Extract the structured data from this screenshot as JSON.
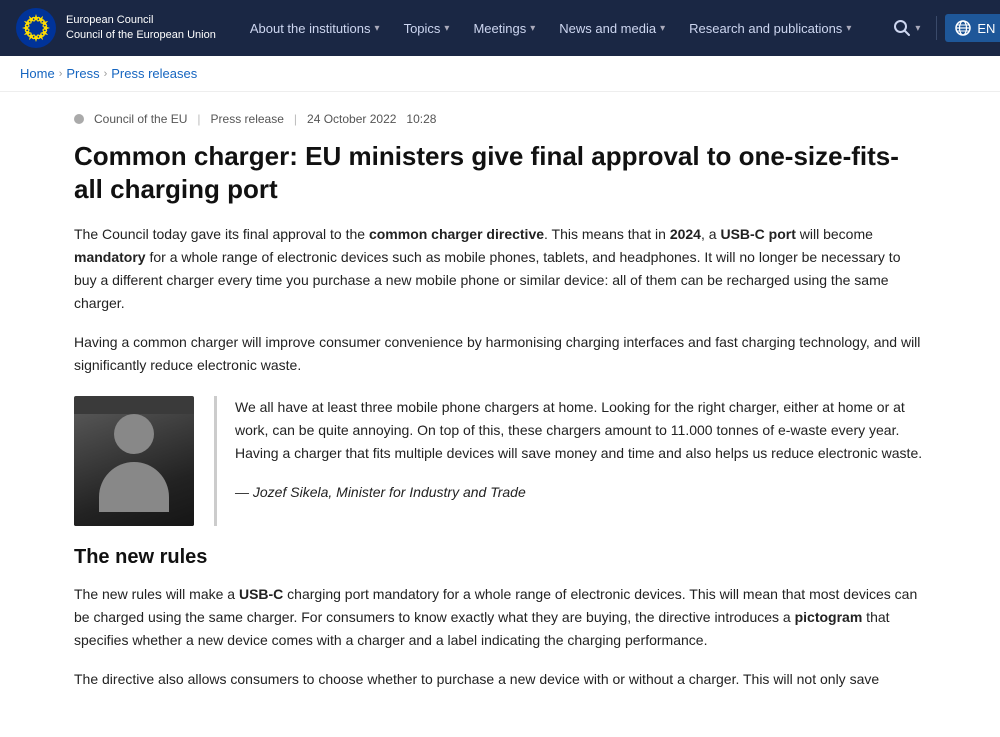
{
  "header": {
    "org_line1": "European Council",
    "org_line2": "Council of the European Union",
    "nav": [
      {
        "label": "About the institutions",
        "has_chevron": true
      },
      {
        "label": "Topics",
        "has_chevron": true
      },
      {
        "label": "Meetings",
        "has_chevron": true
      },
      {
        "label": "News and media",
        "has_chevron": true
      },
      {
        "label": "Research and publications",
        "has_chevron": true
      }
    ],
    "lang_label": "EN"
  },
  "breadcrumb": {
    "home": "Home",
    "press": "Press",
    "press_releases": "Press releases"
  },
  "article": {
    "meta_org": "Council of the EU",
    "meta_type": "Press release",
    "meta_date": "24 October 2022",
    "meta_time": "10:28",
    "title": "Common charger: EU ministers give final approval to one-size-fits-all charging port",
    "para1": "The Council today gave its final approval to the common charger directive. This means that in 2024, a USB-C port will become mandatory for a whole range of electronic devices such as mobile phones, tablets, and headphones. It will no longer be necessary to buy a different charger every time you purchase a new mobile phone or similar device: all of them can be recharged using the same charger.",
    "para1_bold1": "common charger directive",
    "para1_bold2": "2024",
    "para1_bold3": "USB-C port",
    "para1_bold4": "mandatory",
    "para2": "Having a common charger will improve consumer convenience by harmonising charging interfaces and fast charging technology, and will significantly reduce electronic waste.",
    "quote_text": "We all have at least three mobile phone chargers at home. Looking for the right charger, either at home or at work, can be quite annoying. On top of this, these chargers amount to 11.000 tonnes of e-waste every year. Having a charger that fits multiple devices will save money and time and also helps us reduce electronic waste.",
    "quote_attribution": "— Jozef Sikela, Minister for Industry and Trade",
    "section_heading": "The new rules",
    "para3": "The new rules will make a USB-C charging port mandatory for a whole range of electronic devices. This will mean that most devices can be charged using the same charger. For consumers to know exactly what they are buying, the directive introduces a pictogram that specifies whether a new device comes with a charger and a label indicating the charging performance.",
    "para3_bold1": "USB-C",
    "para3_bold2": "pictogram",
    "para4": "The directive also allows consumers to choose whether to purchase a new device with or without a charger. This will not only save"
  }
}
